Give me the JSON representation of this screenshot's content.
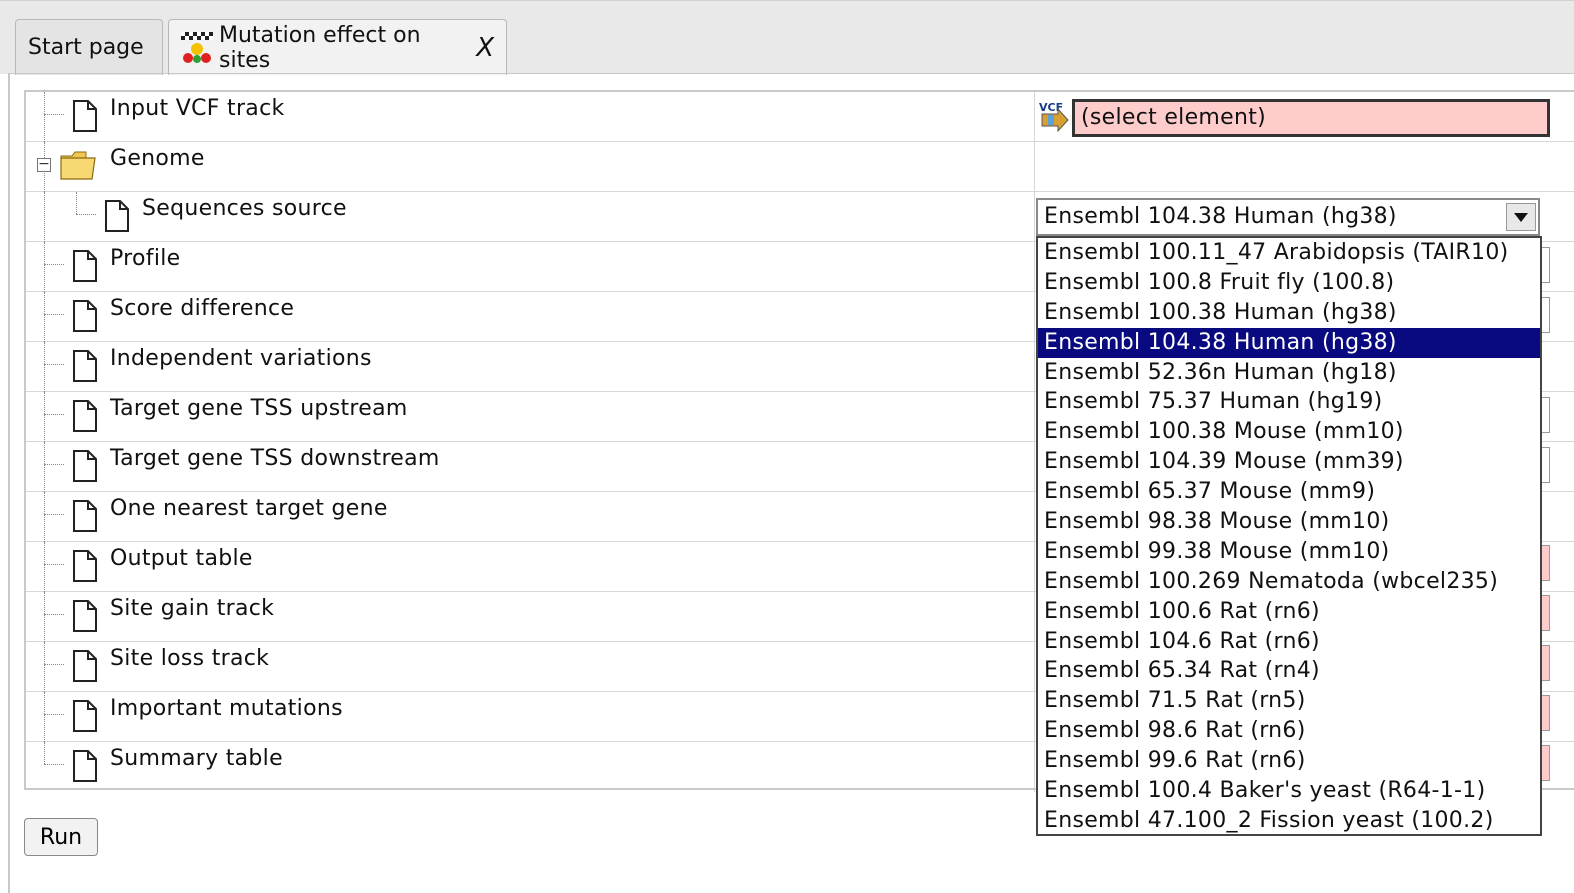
{
  "tabs": [
    {
      "label": "Start page",
      "active": false
    },
    {
      "label": "Mutation effect on sites",
      "active": true,
      "close": "X",
      "icon": "sites-analysis-icon"
    }
  ],
  "tree": {
    "rows": [
      {
        "label": "Input VCF track",
        "type": "file"
      },
      {
        "label": "Genome",
        "type": "folder",
        "expanded": true
      },
      {
        "label": "Sequences source",
        "type": "file",
        "child": true
      },
      {
        "label": "Profile",
        "type": "file"
      },
      {
        "label": "Score difference",
        "type": "file"
      },
      {
        "label": "Independent variations",
        "type": "file"
      },
      {
        "label": "Target gene TSS upstream",
        "type": "file"
      },
      {
        "label": "Target gene TSS downstream",
        "type": "file"
      },
      {
        "label": "One nearest target gene",
        "type": "file"
      },
      {
        "label": "Output table",
        "type": "file"
      },
      {
        "label": "Site gain track",
        "type": "file"
      },
      {
        "label": "Site loss track",
        "type": "file"
      },
      {
        "label": "Important mutations",
        "type": "file"
      },
      {
        "label": "Summary table",
        "type": "file"
      }
    ]
  },
  "input_vcf": {
    "value": "(select element)",
    "icon": "vcf-icon"
  },
  "sequences_source": {
    "selected": "Ensembl 104.38 Human (hg38)",
    "options": [
      "Ensembl 100.11_47 Arabidopsis (TAIR10)",
      "Ensembl 100.8 Fruit fly (100.8)",
      "Ensembl 100.38 Human (hg38)",
      "Ensembl 104.38 Human (hg38)",
      "Ensembl 52.36n Human (hg18)",
      "Ensembl 75.37 Human (hg19)",
      "Ensembl 100.38 Mouse (mm10)",
      "Ensembl 104.39 Mouse (mm39)",
      "Ensembl 65.37 Mouse (mm9)",
      "Ensembl 98.38 Mouse (mm10)",
      "Ensembl 99.38 Mouse (mm10)",
      "Ensembl 100.269 Nematoda (wbcel235)",
      "Ensembl 100.6 Rat (rn6)",
      "Ensembl 104.6 Rat (rn6)",
      "Ensembl 65.34 Rat (rn4)",
      "Ensembl 71.5 Rat (rn5)",
      "Ensembl 98.6 Rat (rn6)",
      "Ensembl 99.6 Rat (rn6)",
      "Ensembl 100.4 Baker's yeast (R64-1-1)",
      "Ensembl 47.100_2 Fission yeast (100.2)"
    ],
    "highlighted_index": 3
  },
  "run_button": {
    "label": "Run"
  },
  "colors": {
    "selection": "#0a0a80",
    "invalid_field": "#ffcccc"
  }
}
